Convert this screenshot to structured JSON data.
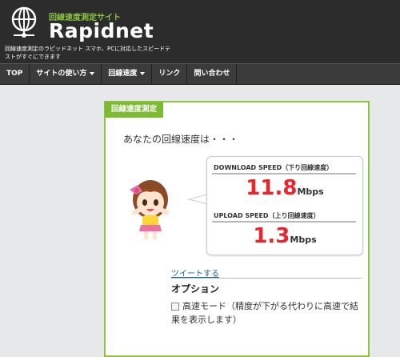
{
  "header": {
    "subtitle": "回線速度測定サイト",
    "title": "Rapidnet",
    "description": "回線速度測定のラピッドネット スマホ、PCに対応したスピードテストがすぐにできます"
  },
  "nav": {
    "items": [
      {
        "label": "TOP"
      },
      {
        "label": "サイトの使い方"
      },
      {
        "label": "回線速度"
      },
      {
        "label": "リンク"
      },
      {
        "label": "問い合わせ"
      }
    ]
  },
  "card": {
    "tag": "回線速度測定",
    "prompt": "あなたの回線速度は・・・",
    "download": {
      "label": "DOWNLOAD SPEED（下り回線速度）",
      "value": "11.8",
      "unit": "Mbps"
    },
    "upload": {
      "label": "UPLOAD SPEED（上り回線速度）",
      "value": "1.3",
      "unit": "Mbps"
    },
    "tweet": "ツイートする",
    "options_title": "オプション",
    "option_fast_mode": "高速モード（精度が下がる代わりに高速で結果を表示します）"
  },
  "colors": {
    "accent": "#8cc63f",
    "speed": "#e8262b",
    "header_bg": "#2c2c2c"
  }
}
